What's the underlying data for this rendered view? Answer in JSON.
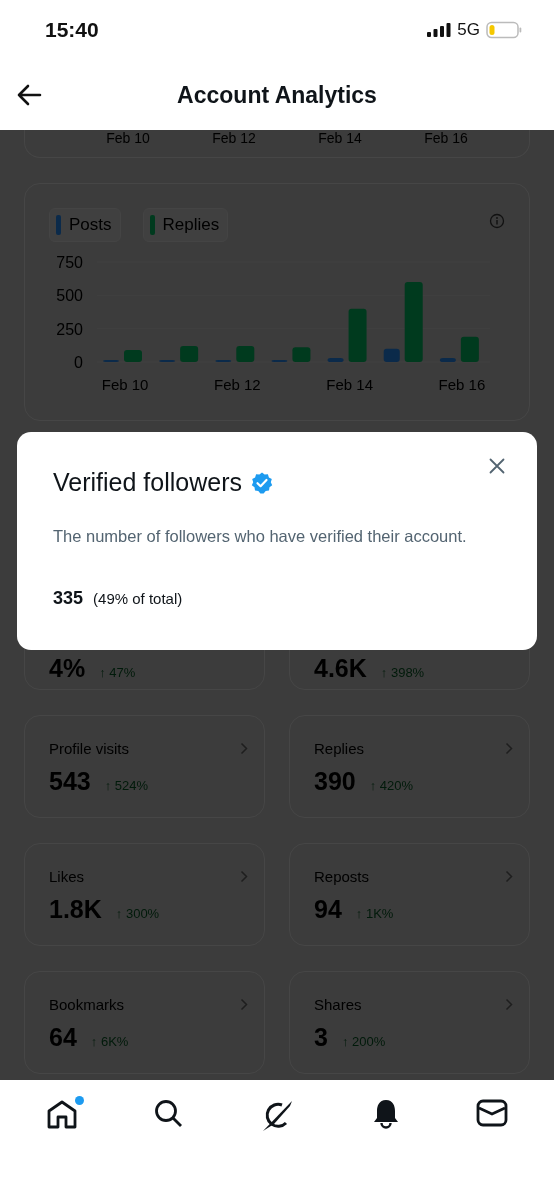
{
  "status_bar": {
    "time": "15:40",
    "network": "5G"
  },
  "header": {
    "title": "Account Analytics"
  },
  "top_card": {
    "axis_labels": [
      "Feb 10",
      "Feb 12",
      "Feb 14",
      "Feb 16"
    ]
  },
  "chart_card": {
    "chart_data": {
      "type": "bar",
      "ylim": [
        0,
        750
      ],
      "yticks": [
        0,
        250,
        500,
        750
      ],
      "categories": [
        "Feb 10",
        null,
        "Feb 12",
        null,
        "Feb 14",
        null,
        "Feb 16"
      ],
      "series": [
        {
          "name": "Posts",
          "color": "#0b2a4a",
          "values": [
            15,
            15,
            15,
            15,
            30,
            100,
            30
          ]
        },
        {
          "name": "Replies",
          "color": "#003a1e",
          "values": [
            90,
            120,
            120,
            110,
            400,
            600,
            190
          ]
        }
      ]
    }
  },
  "metrics": [
    {
      "value": "4%",
      "change": "↑ 47%"
    },
    {
      "value": "4.6K",
      "change": "↑ 398%"
    },
    {
      "label": "Profile visits",
      "value": "543",
      "change": "↑ 524%"
    },
    {
      "label": "Replies",
      "value": "390",
      "change": "↑ 420%"
    },
    {
      "label": "Likes",
      "value": "1.8K",
      "change": "↑ 300%"
    },
    {
      "label": "Reposts",
      "value": "94",
      "change": "↑ 1K%"
    },
    {
      "label": "Bookmarks",
      "value": "64",
      "change": "↑ 6K%"
    },
    {
      "label": "Shares",
      "value": "3",
      "change": "↑ 200%"
    }
  ],
  "dialog": {
    "title": "Verified followers",
    "verified": true,
    "description": "The number of followers who have verified their account.",
    "value": "335",
    "share": "(49% of total)"
  },
  "tab_bar": [
    {
      "kind": "home",
      "badge": true
    },
    {
      "kind": "search",
      "badge": false
    },
    {
      "kind": "grok",
      "badge": false
    },
    {
      "kind": "bell",
      "badge": false
    },
    {
      "kind": "mail",
      "badge": false
    }
  ]
}
